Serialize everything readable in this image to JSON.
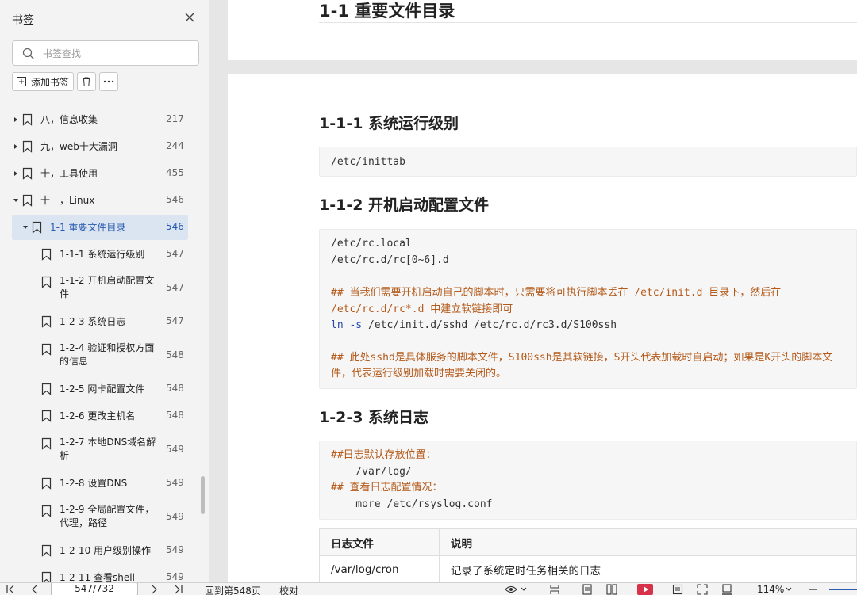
{
  "sidebar": {
    "title": "书签",
    "search_placeholder": "书签查找",
    "add_bookmark_label": "添加书签",
    "items": [
      {
        "label": "八，信息收集",
        "page": "217",
        "expanded": false
      },
      {
        "label": "九，web十大漏洞",
        "page": "244",
        "expanded": false
      },
      {
        "label": "十，工具使用",
        "page": "455",
        "expanded": false
      },
      {
        "label": "十一，Linux",
        "page": "546",
        "expanded": true
      },
      {
        "label": "1-1 重要文件目录",
        "page": "546",
        "expanded": true,
        "active": true
      },
      {
        "label": "1-1-1 系统运行级别",
        "page": "547"
      },
      {
        "label_line1": "1-1-2 开机启动配置文",
        "label_line2": "件",
        "page": "547"
      },
      {
        "label": "1-2-3 系统日志",
        "page": "547"
      },
      {
        "label_line1": "1-2-4 验证和授权方面",
        "label_line2": "的信息",
        "page": "548"
      },
      {
        "label": "1-2-5 网卡配置文件",
        "page": "548"
      },
      {
        "label": "1-2-6 更改主机名",
        "page": "548"
      },
      {
        "label_line1": "1-2-7 本地DNS域名解",
        "label_line2": "析",
        "page": "549"
      },
      {
        "label": "1-2-8 设置DNS",
        "page": "549"
      },
      {
        "label_line1": "1-2-9 全局配置文件，",
        "label_line2": "代理，路径",
        "page": "549"
      },
      {
        "label": "1-2-10 用户级别操作",
        "page": "549"
      },
      {
        "label": "1-2-11 查看shell",
        "page": "549"
      }
    ]
  },
  "document": {
    "h_top": "1-1 重要文件目录",
    "h_111": "1-1-1 系统运行级别",
    "code_111": "/etc/inittab",
    "h_112": "1-1-2 开机启动配置文件",
    "code_112": {
      "l1": "/etc/rc.local",
      "l2": "/etc/rc.d/rc[0~6].d",
      "l3": "## 当我们需要开机启动自己的脚本时，只需要将可执行脚本丢在 /etc/init.d 目录下，然后在",
      "l4": "/etc/rc.d/rc*.d 中建立软链接即可",
      "l5_kw": "ln -s",
      "l5_rest": " /etc/init.d/sshd /etc/rc.d/rc3.d/S100ssh",
      "l6": "## 此处sshd是具体服务的脚本文件，S100ssh是其软链接，S开头代表加载时自启动；如果是K开头的脚本文",
      "l7": "件，代表运行级别加载时需要关闭的。"
    },
    "h_123": "1-2-3 系统日志",
    "code_123": {
      "l1": "##日志默认存放位置：",
      "l2": "    /var/log/",
      "l3": "## 查看日志配置情况：",
      "l4": "    more /etc/rsyslog.conf"
    },
    "table": {
      "headers": [
        "日志文件",
        "说明"
      ],
      "rows": [
        [
          "/var/log/cron",
          "记录了系统定时任务相关的日志"
        ]
      ]
    }
  },
  "statusbar": {
    "page_value": "547/732",
    "back_to_page": "回到第548页",
    "proofread": "校对",
    "zoom": "114%"
  },
  "colors": {
    "active_bg": "#dbe4f1",
    "active_text": "#2a5db0",
    "comment": "#b45a1a",
    "keyword": "#2a4aa8"
  }
}
